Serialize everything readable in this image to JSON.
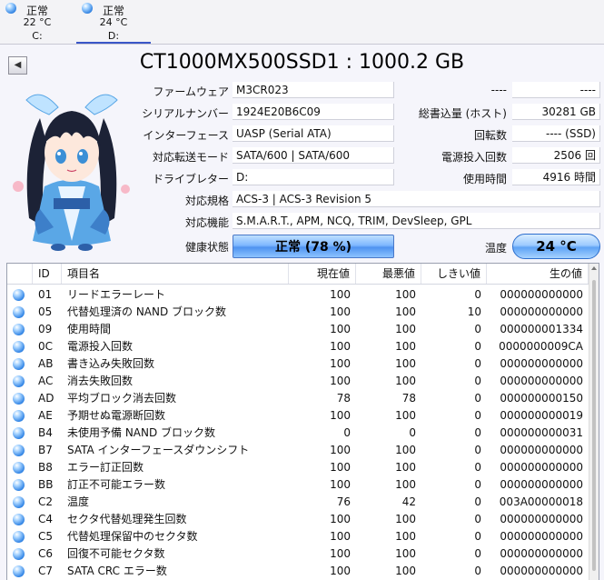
{
  "tabs": [
    {
      "status": "正常",
      "temp": "22 °C",
      "drive": "C:"
    },
    {
      "status": "正常",
      "temp": "24 °C",
      "drive": "D:"
    }
  ],
  "title": "CT1000MX500SSD1 : 1000.2 GB",
  "info": {
    "firmware_label": "ファームウェア",
    "firmware": "M3CR023",
    "serial_label": "シリアルナンバー",
    "serial": "1924E20B6C09",
    "interface_label": "インターフェース",
    "interface": "UASP (Serial ATA)",
    "transfer_label": "対応転送モード",
    "transfer": "SATA/600 | SATA/600",
    "letter_label": "ドライブレター",
    "letter": "D:",
    "standard_label": "対応規格",
    "standard": "ACS-3 | ACS-3 Revision 5",
    "features_label": "対応機能",
    "features": "S.M.A.R.T., APM, NCQ, TRIM, DevSleep, GPL",
    "health_label": "健康状態",
    "health": "正常 (78 %)",
    "temp_label": "温度",
    "temp": "24 °C"
  },
  "right_info": {
    "blank1_label": "----",
    "blank1": "----",
    "hostwrites_label": "総書込量 (ホスト)",
    "hostwrites": "30281 GB",
    "rotation_label": "回転数",
    "rotation": "---- (SSD)",
    "poweron_count_label": "電源投入回数",
    "poweron_count": "2506 回",
    "hours_label": "使用時間",
    "hours": "4916 時間"
  },
  "table": {
    "headers": {
      "id": "ID",
      "name": "項目名",
      "current": "現在値",
      "worst": "最悪値",
      "threshold": "しきい値",
      "raw": "生の値"
    },
    "rows": [
      {
        "id": "01",
        "name": "リードエラーレート",
        "current": "100",
        "worst": "100",
        "threshold": "0",
        "raw": "000000000000"
      },
      {
        "id": "05",
        "name": "代替処理済の NAND ブロック数",
        "current": "100",
        "worst": "100",
        "threshold": "10",
        "raw": "000000000000"
      },
      {
        "id": "09",
        "name": "使用時間",
        "current": "100",
        "worst": "100",
        "threshold": "0",
        "raw": "000000001334"
      },
      {
        "id": "0C",
        "name": "電源投入回数",
        "current": "100",
        "worst": "100",
        "threshold": "0",
        "raw": "0000000009CA"
      },
      {
        "id": "AB",
        "name": "書き込み失敗回数",
        "current": "100",
        "worst": "100",
        "threshold": "0",
        "raw": "000000000000"
      },
      {
        "id": "AC",
        "name": "消去失敗回数",
        "current": "100",
        "worst": "100",
        "threshold": "0",
        "raw": "000000000000"
      },
      {
        "id": "AD",
        "name": "平均ブロック消去回数",
        "current": "78",
        "worst": "78",
        "threshold": "0",
        "raw": "000000000150"
      },
      {
        "id": "AE",
        "name": "予期せぬ電源断回数",
        "current": "100",
        "worst": "100",
        "threshold": "0",
        "raw": "000000000019"
      },
      {
        "id": "B4",
        "name": "未使用予備 NAND ブロック数",
        "current": "0",
        "worst": "0",
        "threshold": "0",
        "raw": "000000000031"
      },
      {
        "id": "B7",
        "name": "SATA インターフェースダウンシフト",
        "current": "100",
        "worst": "100",
        "threshold": "0",
        "raw": "000000000000"
      },
      {
        "id": "B8",
        "name": "エラー訂正回数",
        "current": "100",
        "worst": "100",
        "threshold": "0",
        "raw": "000000000000"
      },
      {
        "id": "BB",
        "name": "訂正不可能エラー数",
        "current": "100",
        "worst": "100",
        "threshold": "0",
        "raw": "000000000000"
      },
      {
        "id": "C2",
        "name": "温度",
        "current": "76",
        "worst": "42",
        "threshold": "0",
        "raw": "003A00000018"
      },
      {
        "id": "C4",
        "name": "セクタ代替処理発生回数",
        "current": "100",
        "worst": "100",
        "threshold": "0",
        "raw": "000000000000"
      },
      {
        "id": "C5",
        "name": "代替処理保留中のセクタ数",
        "current": "100",
        "worst": "100",
        "threshold": "0",
        "raw": "000000000000"
      },
      {
        "id": "C6",
        "name": "回復不可能セクタ数",
        "current": "100",
        "worst": "100",
        "threshold": "0",
        "raw": "000000000000"
      },
      {
        "id": "C7",
        "name": "SATA CRC エラー数",
        "current": "100",
        "worst": "100",
        "threshold": "0",
        "raw": "000000000000"
      }
    ]
  },
  "colors": {
    "status_good": "#3386e6",
    "accent": "#3a56c8"
  }
}
